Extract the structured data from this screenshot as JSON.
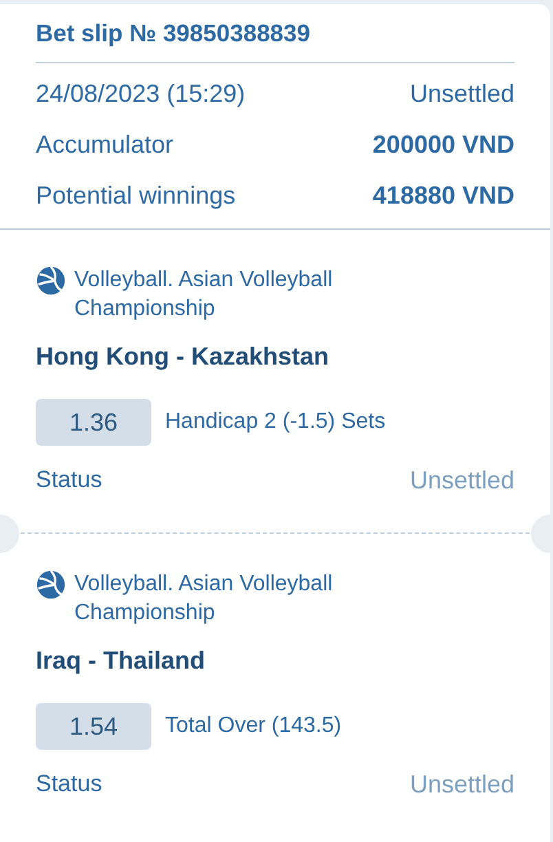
{
  "title": "Bet slip № 39850388839",
  "summary": [
    {
      "label": "24/08/2023 (15:29)",
      "value": "Unsettled",
      "bold": false
    },
    {
      "label": "Accumulator",
      "value": "200000 VND",
      "bold": true
    },
    {
      "label": "Potential winnings",
      "value": "418880 VND",
      "bold": true
    }
  ],
  "events": [
    {
      "league": "Volleyball. Asian Volleyball Championship",
      "match": "Hong Kong - Kazakhstan",
      "odds": "1.36",
      "market": "Handicap 2 (-1.5) Sets",
      "status_label": "Status",
      "status": "Unsettled"
    },
    {
      "league": "Volleyball. Asian Volleyball Championship",
      "match": "Iraq - Thailand",
      "odds": "1.54",
      "market": "Total Over (143.5)",
      "status_label": "Status",
      "status": "Unsettled"
    }
  ]
}
